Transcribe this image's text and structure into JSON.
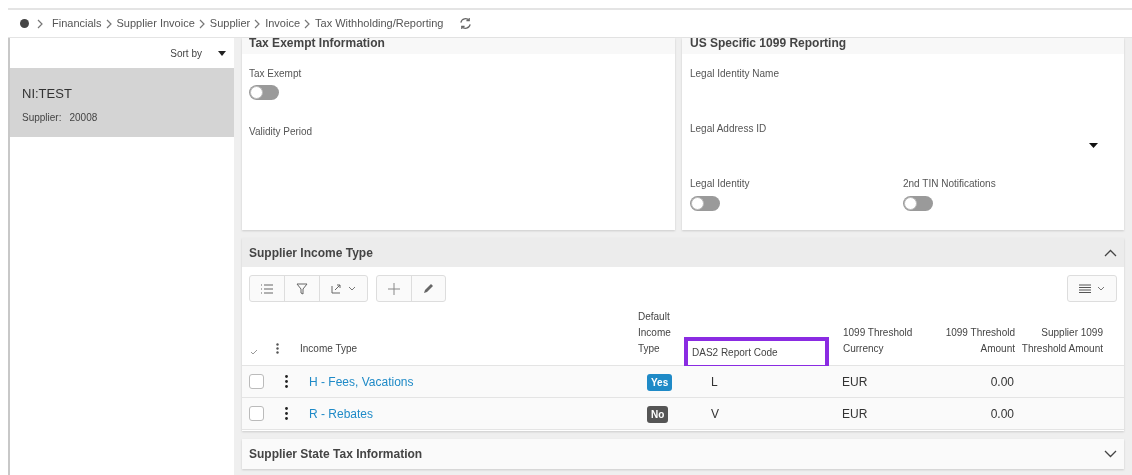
{
  "breadcrumb": {
    "items": [
      "Financials",
      "Supplier Invoice",
      "Supplier",
      "Invoice",
      "Tax Withholding/Reporting"
    ]
  },
  "sidebar": {
    "sort_label": "Sort by",
    "items": [
      {
        "title": "NI:TEST",
        "label": "Supplier:",
        "value": "20008",
        "selected": true
      }
    ]
  },
  "tax_exempt": {
    "title": "Tax Exempt Information",
    "fields": [
      {
        "kind": "toggle",
        "label": "Tax Exempt",
        "on": false
      },
      {
        "kind": "text",
        "label": "Validity Period"
      }
    ]
  },
  "us_1099": {
    "title": "US Specific 1099 Reporting",
    "fields": [
      {
        "kind": "text",
        "label": "Legal Identity Name"
      },
      {
        "kind": "select",
        "label": "Legal Address ID"
      }
    ],
    "toggles": [
      {
        "label": "Legal Identity",
        "on": false
      },
      {
        "label": "2nd TIN Notifications",
        "on": false
      }
    ]
  },
  "income_type": {
    "title": "Supplier Income Type",
    "expanded": true,
    "columns": [
      {
        "label": "Income Type",
        "highlighted": false
      },
      {
        "label": "Default Income Type",
        "highlighted": false
      },
      {
        "label": "DAS2 Report Code",
        "highlighted": true
      },
      {
        "label": "1099 Threshold Currency",
        "highlighted": false
      },
      {
        "label": "1099 Threshold Amount",
        "highlighted": false
      },
      {
        "label": "Supplier 1099 Threshold Amount",
        "highlighted": false
      }
    ],
    "rows": [
      {
        "checked": false,
        "income_type": "H - Fees, Vacations",
        "default": true,
        "default_label": "Yes",
        "das2": "L",
        "currency": "EUR",
        "amount": "0.00"
      },
      {
        "checked": false,
        "income_type": "R - Rebates",
        "default": false,
        "default_label": "No",
        "das2": "V",
        "currency": "EUR",
        "amount": "0.00"
      }
    ]
  },
  "state_tax": {
    "title": "Supplier State Tax Information",
    "expanded": false
  }
}
